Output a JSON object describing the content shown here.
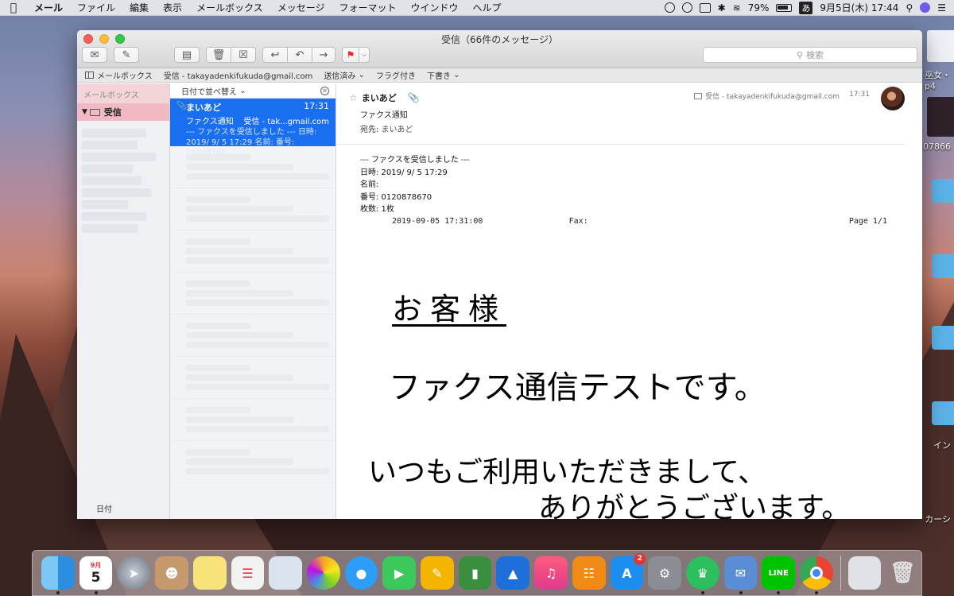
{
  "menubar": {
    "app": "メール",
    "items": [
      "ファイル",
      "編集",
      "表示",
      "メールボックス",
      "メッセージ",
      "フォーマット",
      "ウインドウ",
      "ヘルプ"
    ],
    "battery": "79%",
    "ime": "あ",
    "clock": "9月5日(木)  17:44"
  },
  "desktop": {
    "label1": "巫女・\np4",
    "label2": "07866",
    "label3": "イン",
    "label4": "カーシ"
  },
  "window": {
    "title": "受信（66件のメッセージ）",
    "search_placeholder": "検索"
  },
  "favorites": {
    "mailboxes": "メールボックス",
    "inbox": "受信 - takayadenkifukuda@gmail.com",
    "sent": "送信済み",
    "flagged": "フラグ付き",
    "drafts": "下書き"
  },
  "sidebar": {
    "header": "メールボックス",
    "inbox": "受信",
    "footer": "日付"
  },
  "message_list": {
    "sort": "日付で並べ替え",
    "selected": {
      "from": "まいあど",
      "time": "17:31",
      "subject": "ファクス通知",
      "mailbox": "受信 - tak...gmail.com",
      "preview": "--- ファクスを受信しました --- 日時: 2019/ 9/ 5 17:29 名前: 番号: 01208786..."
    }
  },
  "message": {
    "from": "まいあど",
    "mailbox": "受信 - takayadenkifukuda@gmail.com",
    "time": "17:31",
    "subject": "ファクス通知",
    "to_label": "宛先:",
    "to": "まいあど",
    "body": [
      "--- ファクスを受信しました ---",
      "日時: 2019/ 9/ 5 17:29",
      "名前:",
      "番号: 0120878670",
      "枚数: 1枚"
    ],
    "fax": {
      "timestamp": "2019-09-05 17:31:00",
      "fax_label": "Fax:",
      "page": "Page 1/1",
      "title": "お客様",
      "line1": "ファクス通信テストです。",
      "line2": "いつもご利用いただきまして、",
      "line3": "ありがとうございます。"
    }
  },
  "dock": {
    "calendar_month": "9月",
    "calendar_day": "5",
    "appstore_badge": "2"
  }
}
